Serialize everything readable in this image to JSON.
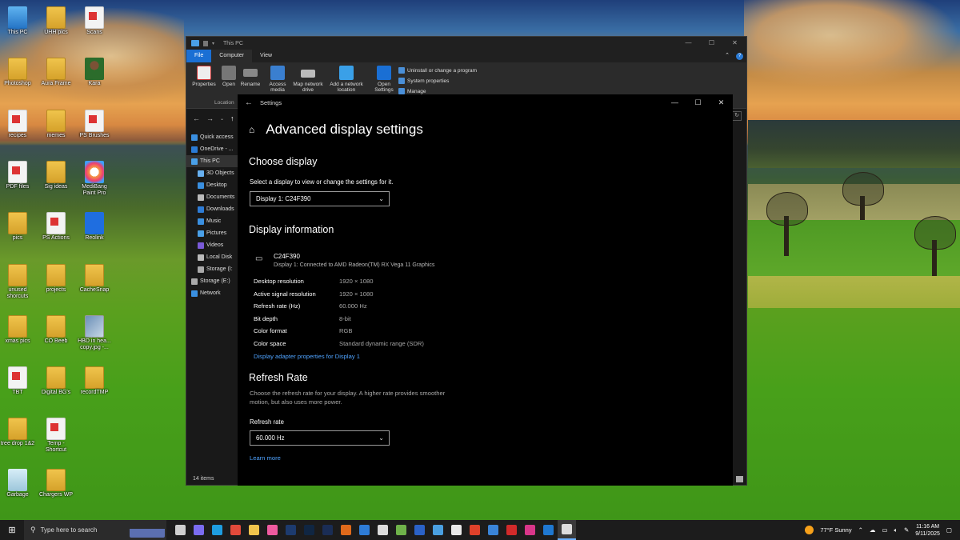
{
  "desktop": {
    "icons": [
      {
        "label": "This PC",
        "icon": "this-pc-icon"
      },
      {
        "label": "UHH pics",
        "icon": "folder-icon"
      },
      {
        "label": "Scans",
        "icon": "document-icon"
      },
      {
        "label": "Photoshop",
        "icon": "folder-icon"
      },
      {
        "label": "Aura Frame",
        "icon": "folder-icon"
      },
      {
        "label": "Kara",
        "icon": "person-icon"
      },
      {
        "label": "recipes",
        "icon": "document-icon"
      },
      {
        "label": "memes",
        "icon": "folder-icon"
      },
      {
        "label": "PS Brushes",
        "icon": "document-icon"
      },
      {
        "label": "PDF files",
        "icon": "document-icon"
      },
      {
        "label": "Sig ideas",
        "icon": "folder-icon"
      },
      {
        "label": "MediBang Paint Pro",
        "icon": "medibang-icon"
      },
      {
        "label": "pics",
        "icon": "folder-icon"
      },
      {
        "label": "PS Actions",
        "icon": "document-icon"
      },
      {
        "label": "Reolink",
        "icon": "reolink-icon"
      },
      {
        "label": "unused shorcuts",
        "icon": "folder-icon"
      },
      {
        "label": "projects",
        "icon": "folder-icon"
      },
      {
        "label": "CacheSnap",
        "icon": "folder-icon"
      },
      {
        "label": "xmas pics",
        "icon": "folder-icon"
      },
      {
        "label": "CO Beeb",
        "icon": "folder-icon"
      },
      {
        "label": "HBD in hea... copy.jpg -...",
        "icon": "image-icon"
      },
      {
        "label": "TBT",
        "icon": "document-icon"
      },
      {
        "label": "Digital BG's",
        "icon": "folder-icon"
      },
      {
        "label": "recordTMP",
        "icon": "folder-icon"
      },
      {
        "label": "tree drop 1&2",
        "icon": "folder-icon"
      },
      {
        "label": "Temp - Shortcut",
        "icon": "document-icon"
      },
      {
        "label": "Garbage",
        "icon": "recycle-bin-icon"
      },
      {
        "label": "Chargers WP",
        "icon": "folder-icon"
      }
    ]
  },
  "explorer": {
    "title": "This PC",
    "tabs": [
      "File",
      "Computer",
      "View"
    ],
    "ribbon": {
      "properties": "Properties",
      "open": "Open",
      "rename": "Rename",
      "access_media": "Access media",
      "map_network": "Map network drive",
      "add_network": "Add a network location",
      "open_settings": "Open Settings",
      "uninstall": "Uninstall or change a program",
      "system_properties": "System properties",
      "manage": "Manage",
      "location_group": "Location"
    },
    "sidebar": [
      {
        "label": "Quick access",
        "top": true
      },
      {
        "label": "OneDrive - ...",
        "top": true
      },
      {
        "label": "This PC",
        "top": true,
        "selected": true
      },
      {
        "label": "3D Objects"
      },
      {
        "label": "Desktop"
      },
      {
        "label": "Documents"
      },
      {
        "label": "Downloads"
      },
      {
        "label": "Music"
      },
      {
        "label": "Pictures"
      },
      {
        "label": "Videos"
      },
      {
        "label": "Local Disk"
      },
      {
        "label": "Storage (I:"
      },
      {
        "label": "Storage (E:)",
        "top": true
      },
      {
        "label": "Network",
        "top": true
      }
    ],
    "status": "14 items"
  },
  "settings": {
    "window_title": "Settings",
    "page_title": "Advanced display settings",
    "choose_display": {
      "heading": "Choose display",
      "label": "Select a display to view or change the settings for it.",
      "selected": "Display 1: C24F390"
    },
    "display_info": {
      "heading": "Display information",
      "monitor_name": "C24F390",
      "monitor_sub": "Display 1: Connected to AMD Radeon(TM) RX Vega 11 Graphics",
      "rows": [
        {
          "label": "Desktop resolution",
          "value": "1920 × 1080"
        },
        {
          "label": "Active signal resolution",
          "value": "1920 × 1080"
        },
        {
          "label": "Refresh rate (Hz)",
          "value": "60.000 Hz"
        },
        {
          "label": "Bit depth",
          "value": "8-bit"
        },
        {
          "label": "Color format",
          "value": "RGB"
        },
        {
          "label": "Color space",
          "value": "Standard dynamic range (SDR)"
        }
      ],
      "adapter_link": "Display adapter properties for Display 1"
    },
    "refresh": {
      "heading": "Refresh Rate",
      "desc": "Choose the refresh rate for your display. A higher rate provides smoother motion, but also uses more power.",
      "label": "Refresh rate",
      "selected": "60.000 Hz",
      "learn_more": "Learn more"
    }
  },
  "taskbar": {
    "search_placeholder": "Type here to search",
    "weather": "77°F  Sunny",
    "time": "11:16 AM",
    "date": "9/11/2025",
    "apps": [
      {
        "name": "task-view-icon",
        "color": "#cfcfcf"
      },
      {
        "name": "copilot-icon",
        "color": "#7b6cf0"
      },
      {
        "name": "edge-icon",
        "color": "#1e9de0"
      },
      {
        "name": "chrome-icon",
        "color": "#e24a3b"
      },
      {
        "name": "file-explorer-icon",
        "color": "#f0c44c"
      },
      {
        "name": "photos-icon",
        "color": "#ef5aa0"
      },
      {
        "name": "photoshop-icon",
        "color": "#1d3b6e"
      },
      {
        "name": "photoshop-alt-icon",
        "color": "#102642"
      },
      {
        "name": "lightroom-classic-icon",
        "color": "#1a2d55"
      },
      {
        "name": "settings-gear-orange-icon",
        "color": "#e06a1b"
      },
      {
        "name": "app-blue-icon",
        "color": "#2e7cd6"
      },
      {
        "name": "terminal-icon",
        "color": "#dcdcdc"
      },
      {
        "name": "notepad-icon",
        "color": "#6fb24a"
      },
      {
        "name": "word-icon",
        "color": "#2b62c7"
      },
      {
        "name": "mail-icon",
        "color": "#4a9fe0"
      },
      {
        "name": "app-green-icon",
        "color": "#e9e9e9"
      },
      {
        "name": "office-icon",
        "color": "#e0412a"
      },
      {
        "name": "snip-icon",
        "color": "#3a84d8"
      },
      {
        "name": "record-icon",
        "color": "#d22a2a"
      },
      {
        "name": "instagram-icon",
        "color": "#d8368a"
      },
      {
        "name": "outlook-icon",
        "color": "#1f78d1"
      },
      {
        "name": "settings-icon",
        "color": "#dddddd"
      }
    ]
  }
}
